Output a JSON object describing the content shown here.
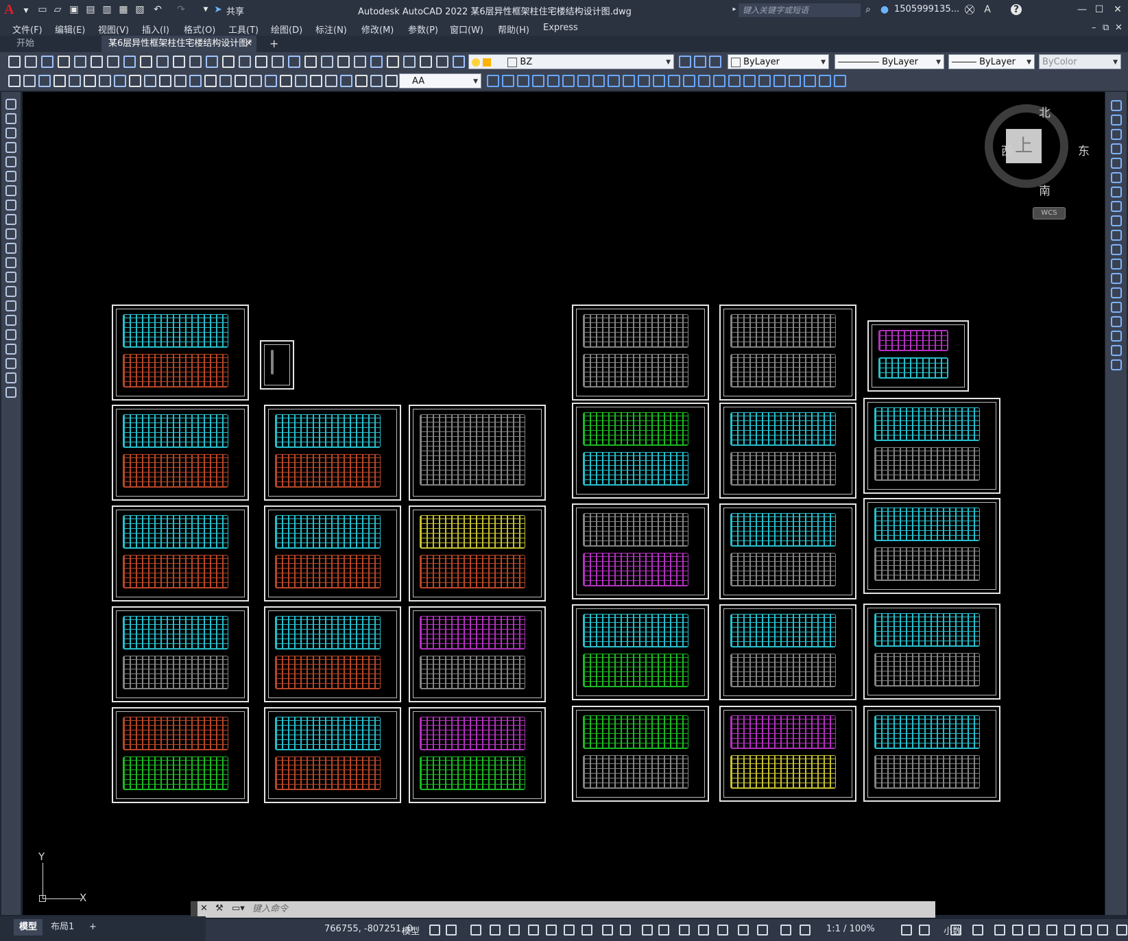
{
  "window": {
    "title": "Autodesk AutoCAD 2022    某6层异性框架柱住宅楼结构设计图.dwg",
    "logo": "A",
    "share_label": "共享",
    "search_placeholder": "键入关键字或短语",
    "user": "1505999135...",
    "help": "?"
  },
  "menu": [
    "文件(F)",
    "编辑(E)",
    "视图(V)",
    "插入(I)",
    "格式(O)",
    "工具(T)",
    "绘图(D)",
    "标注(N)",
    "修改(M)",
    "参数(P)",
    "窗口(W)",
    "帮助(H)",
    "Express"
  ],
  "tabs": {
    "start": "开始",
    "document": "某6层异性框架柱住宅楼结构设计图*",
    "add": "+"
  },
  "toolbar": {
    "layer": "BZ",
    "color": "ByLayer",
    "linetype": "ByLayer",
    "lineweight": "ByLayer",
    "plotstyle": "ByColor",
    "textstyle": "AA"
  },
  "viewcube": {
    "north": "北",
    "south": "南",
    "east": "东",
    "west": "西",
    "face": "上",
    "wcs": "WCS"
  },
  "ucs": {
    "x": "X",
    "y": "Y"
  },
  "command": {
    "placeholder": "键入命令"
  },
  "layout_tabs": [
    "模型",
    "布局1"
  ],
  "status": {
    "coords": "766755, -807251, 0",
    "space": "模型",
    "scale": "1:1 / 100%",
    "units": "小数"
  },
  "colors": {
    "cyan": "#2fe0f0",
    "red": "#d9532f",
    "green": "#22d92a",
    "yellow": "#e9e23c",
    "magenta": "#d23be0"
  }
}
